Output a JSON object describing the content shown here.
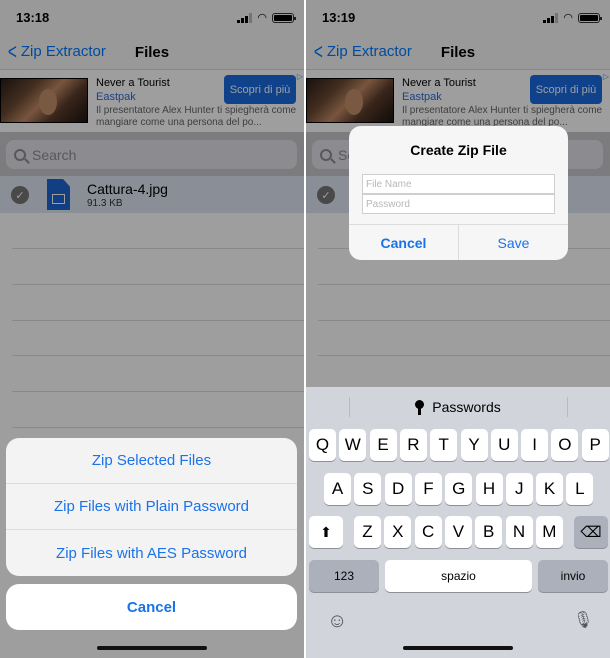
{
  "left": {
    "status": {
      "time": "13:18"
    },
    "nav": {
      "back_label": "Zip Extractor",
      "title": "Files"
    },
    "ad": {
      "title": "Never a Tourist",
      "brand": "Eastpak",
      "description": "Il presentatore Alex Hunter ti spiegherà come mangiare come una persona del po...",
      "cta": "Scopri di più",
      "adchoices_icon": "▷"
    },
    "search": {
      "placeholder": "Search"
    },
    "files": [
      {
        "name": "Cattura-4.jpg",
        "size": "91.3 KB",
        "selected": true
      }
    ],
    "action_sheet": {
      "items": [
        "Zip Selected Files",
        "Zip Files with Plain Password",
        "Zip Files with AES Password"
      ],
      "cancel": "Cancel"
    }
  },
  "right": {
    "status": {
      "time": "13:19"
    },
    "nav": {
      "back_label": "Zip Extractor",
      "title": "Files"
    },
    "ad": {
      "title": "Never a Tourist",
      "brand": "Eastpak",
      "description": "Il presentatore Alex Hunter ti spiegherà come mangiare come una persona del po...",
      "cta": "Scopri di più",
      "adchoices_icon": "▷"
    },
    "search": {
      "placeholder": "Search"
    },
    "alert": {
      "title": "Create Zip File",
      "file_name_placeholder": "File Name",
      "password_placeholder": "Password",
      "cancel": "Cancel",
      "save": "Save"
    },
    "keyboard": {
      "suggestion": "Passwords",
      "row1": [
        "Q",
        "W",
        "E",
        "R",
        "T",
        "Y",
        "U",
        "I",
        "O",
        "P"
      ],
      "row2": [
        "A",
        "S",
        "D",
        "F",
        "G",
        "H",
        "J",
        "K",
        "L"
      ],
      "row3": [
        "Z",
        "X",
        "C",
        "V",
        "B",
        "N",
        "M"
      ],
      "shift_icon": "⬆",
      "delete_icon": "⌫",
      "numbers": "123",
      "space": "spazio",
      "return": "invio",
      "emoji_icon": "☺",
      "mic_icon": "🎙"
    }
  },
  "colors": {
    "accent": "#1a73e8",
    "ad_cta": "#1a6be0",
    "selected_row": "#dde6f4",
    "keyboard_bg": "#d1d4da"
  }
}
